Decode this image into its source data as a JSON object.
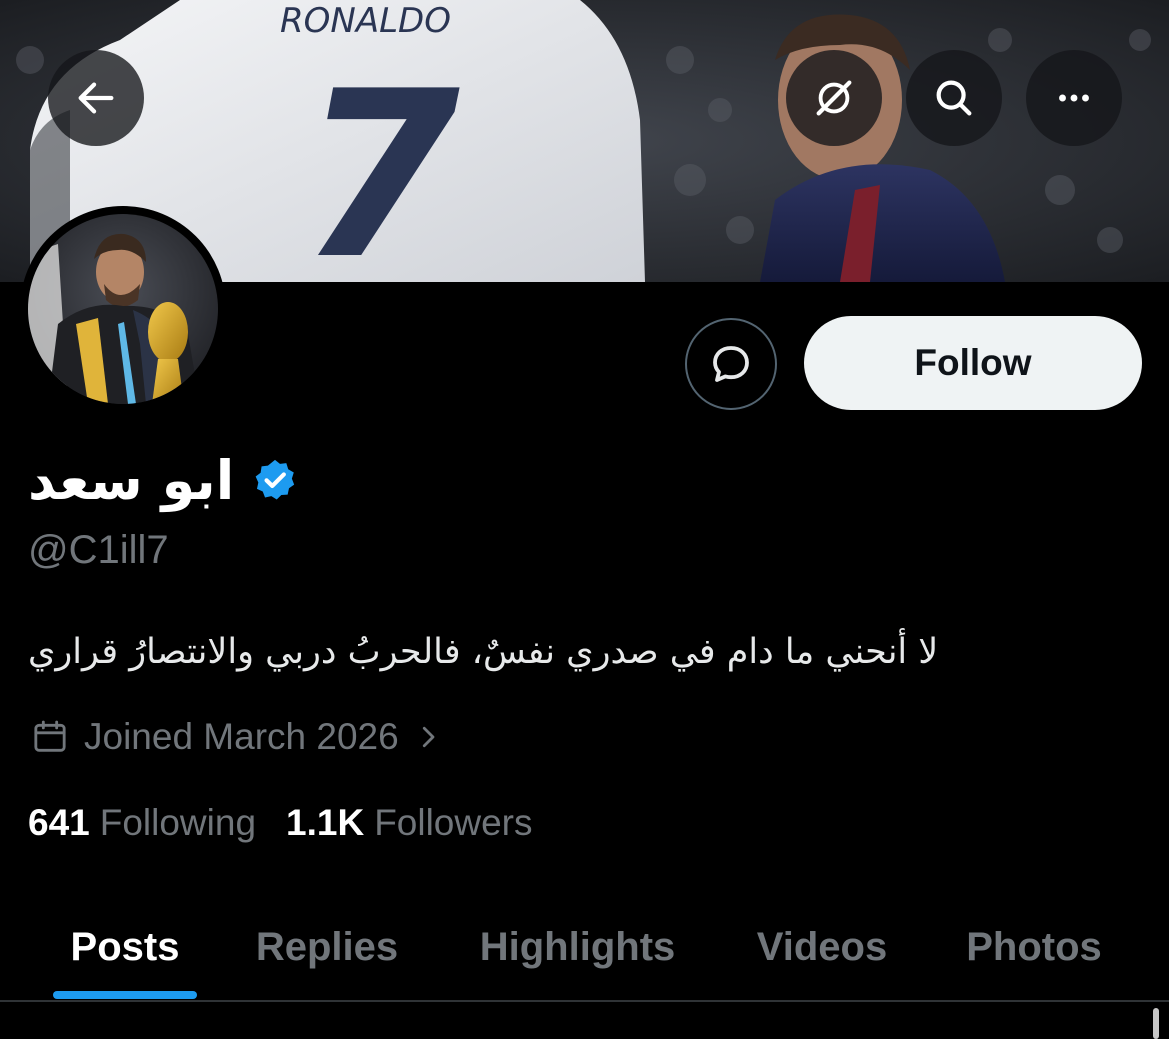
{
  "banner": {
    "jersey_name": "RONALDO",
    "jersey_number": "7",
    "back_icon": "arrow-left-icon",
    "grok_icon": "grok-slash-icon",
    "search_icon": "search-icon",
    "more_icon": "more-horizontal-icon"
  },
  "profile": {
    "display_name": "ابو سعد",
    "verified": true,
    "verified_color": "#1d9bf0",
    "handle": "@C1ill7",
    "bio": "لا أنحني ما دام في صدري نفسٌ، فالحربُ دربي والانتصارُ قراري",
    "joined": "Joined March 2026",
    "following_count": "641",
    "following_label": "Following",
    "followers_count": "1.1K",
    "followers_label": "Followers"
  },
  "actions": {
    "message_icon": "message-bubble-icon",
    "follow_label": "Follow"
  },
  "tabs": [
    {
      "label": "Posts",
      "active": true
    },
    {
      "label": "Replies",
      "active": false
    },
    {
      "label": "Highlights",
      "active": false
    },
    {
      "label": "Videos",
      "active": false
    },
    {
      "label": "Photos",
      "active": false
    }
  ],
  "colors": {
    "background": "#000000",
    "accent": "#1d9bf0",
    "muted_text": "#71767b",
    "follow_button_bg": "#eff3f4"
  }
}
